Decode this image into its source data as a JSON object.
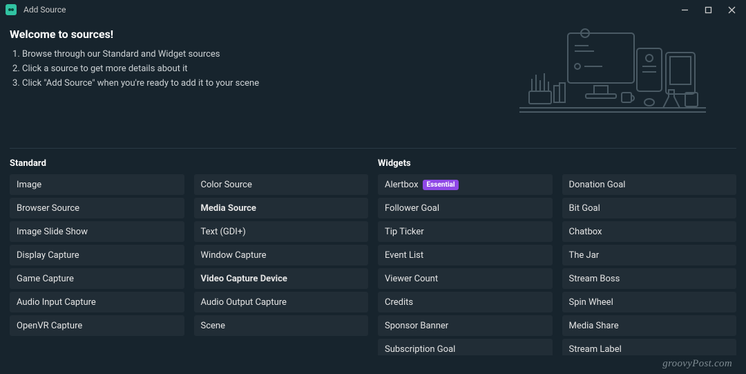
{
  "window": {
    "title": "Add Source"
  },
  "welcome": {
    "heading": "Welcome to sources!",
    "steps": [
      "Browse through our Standard and Widget sources",
      "Click a source to get more details about it",
      "Click \"Add Source\" when you're ready to add it to your scene"
    ]
  },
  "sections": {
    "standard": {
      "title": "Standard",
      "col1": [
        {
          "label": "Image"
        },
        {
          "label": "Browser Source"
        },
        {
          "label": "Image Slide Show"
        },
        {
          "label": "Display Capture"
        },
        {
          "label": "Game Capture"
        },
        {
          "label": "Audio Input Capture"
        },
        {
          "label": "OpenVR Capture"
        }
      ],
      "col2": [
        {
          "label": "Color Source"
        },
        {
          "label": "Media Source",
          "bold": true
        },
        {
          "label": "Text (GDI+)"
        },
        {
          "label": "Window Capture"
        },
        {
          "label": "Video Capture Device",
          "bold": true
        },
        {
          "label": "Audio Output Capture"
        },
        {
          "label": "Scene"
        }
      ]
    },
    "widgets": {
      "title": "Widgets",
      "badge": "Essential",
      "col1": [
        {
          "label": "Alertbox",
          "badge": true
        },
        {
          "label": "Follower Goal"
        },
        {
          "label": "Tip Ticker"
        },
        {
          "label": "Event List"
        },
        {
          "label": "Viewer Count"
        },
        {
          "label": "Credits"
        },
        {
          "label": "Sponsor Banner"
        },
        {
          "label": "Subscription Goal"
        }
      ],
      "col2": [
        {
          "label": "Donation Goal"
        },
        {
          "label": "Bit Goal"
        },
        {
          "label": "Chatbox"
        },
        {
          "label": "The Jar"
        },
        {
          "label": "Stream Boss"
        },
        {
          "label": "Spin Wheel"
        },
        {
          "label": "Media Share"
        },
        {
          "label": "Stream Label"
        }
      ]
    }
  },
  "watermark": "groovyPost.com"
}
